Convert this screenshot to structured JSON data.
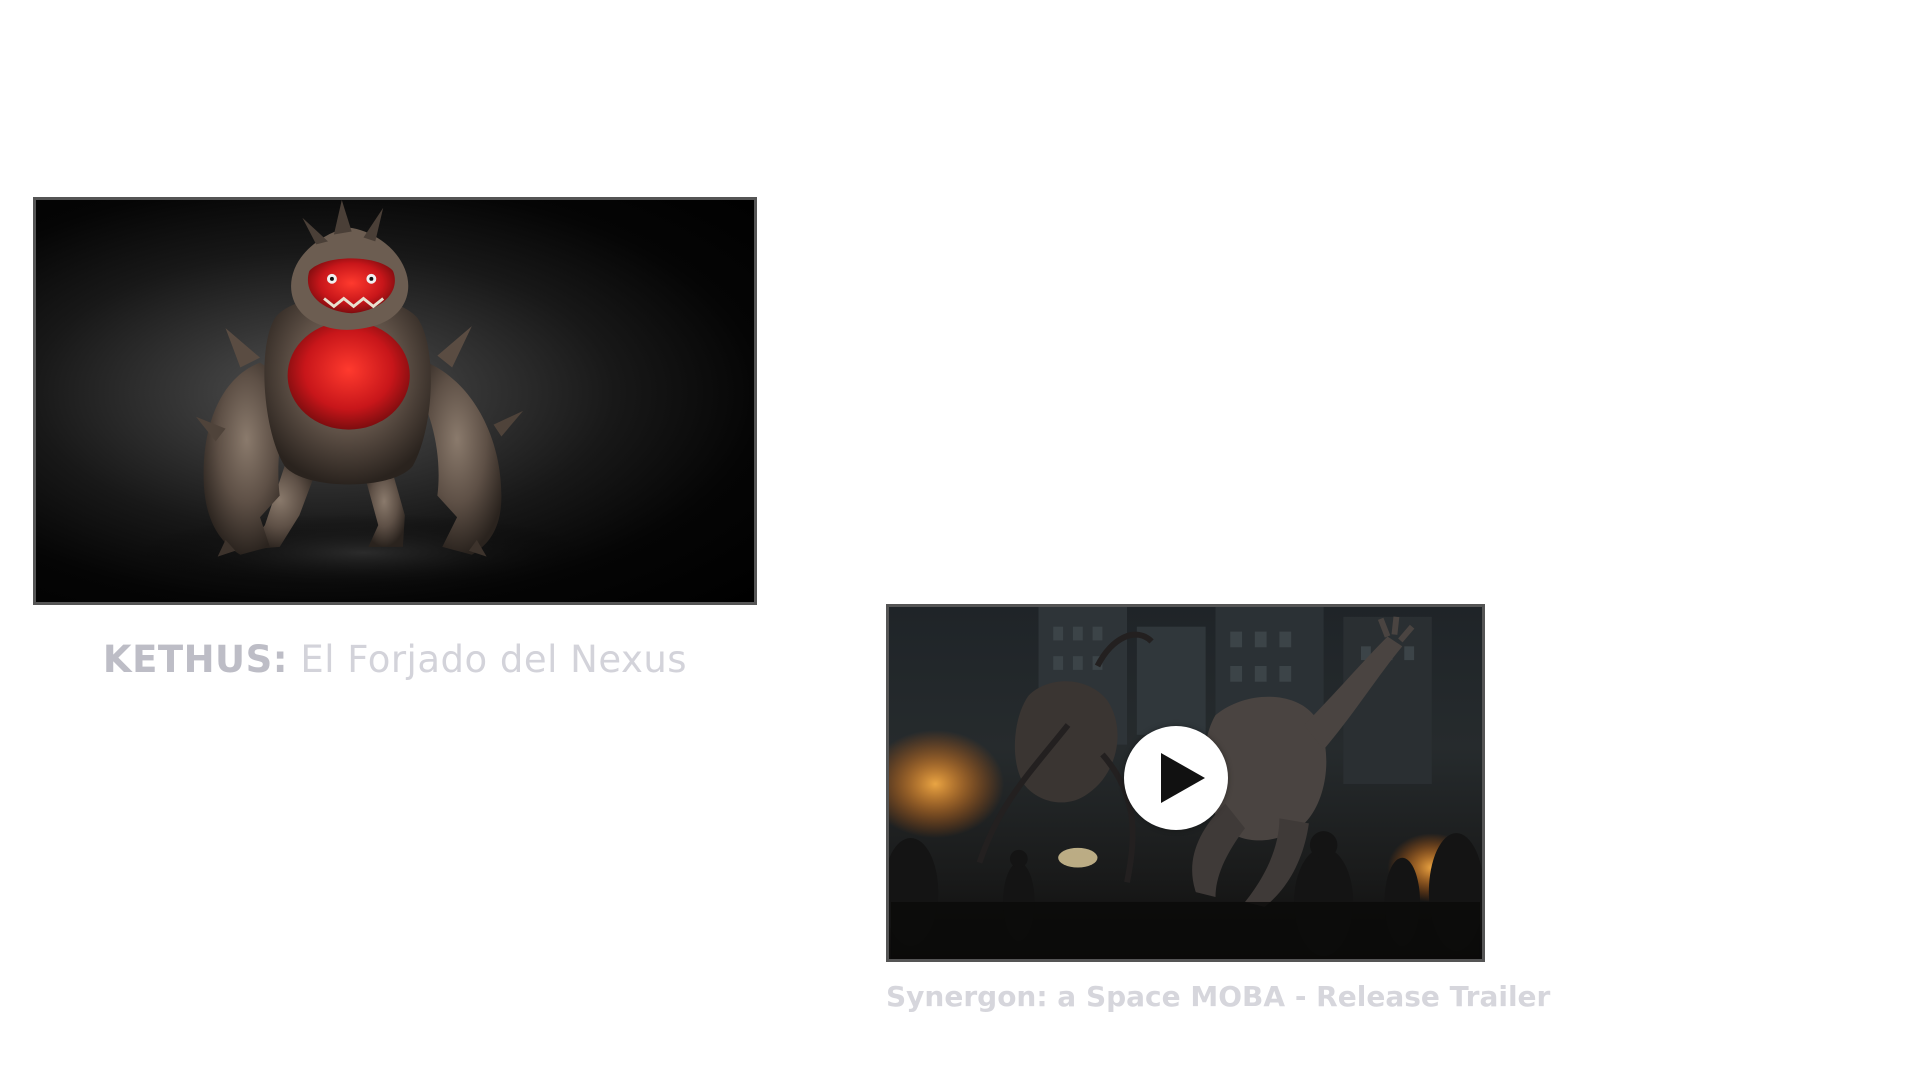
{
  "videos": [
    {
      "title_strong": "KETHUS:",
      "title_rest": "El Forjado del Nexus",
      "thumbnail": "kethus-monster-render"
    },
    {
      "title": "Synergon: a Space MOBA - Release Trailer",
      "thumbnail": "monster-city-battle-scene",
      "play_icon": "play-icon"
    }
  ],
  "colors": {
    "background": "#ffffff",
    "card_border": "#555555",
    "title_text": "#d3d3da",
    "monster_red": "#c8161a"
  }
}
